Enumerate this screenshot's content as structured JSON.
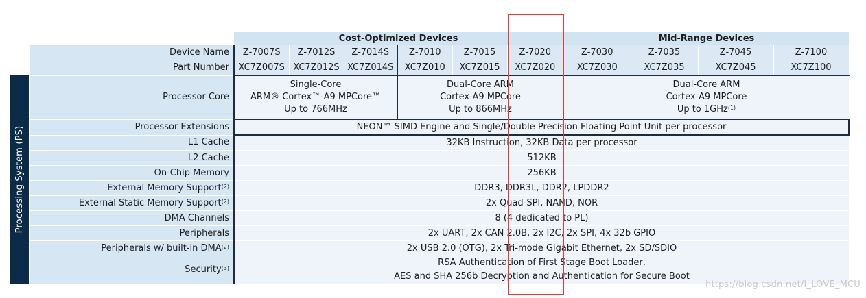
{
  "groups": {
    "cost": "Cost-Optimized Devices",
    "mid": "Mid-Range Devices"
  },
  "side_label": "Processing System (PS)",
  "labels": {
    "device_name": "Device Name",
    "part_number": "Part Number",
    "processor_core": "Processor Core",
    "processor_extensions": "Processor Extensions",
    "l1_cache": "L1 Cache",
    "l2_cache": "L2 Cache",
    "on_chip_memory": "On-Chip Memory",
    "ext_memory": "External Memory Support",
    "ext_static_memory": "External Static Memory Support",
    "dma": "DMA Channels",
    "peripherals": "Peripherals",
    "peripherals_dma": "Peripherals w/ built-in DMA",
    "security": "Security"
  },
  "footnotes": {
    "ext_memory": "(2)",
    "ext_static_memory": "(2)",
    "peripherals_dma": "(2)",
    "security": "(3)",
    "ghz": "(1)"
  },
  "devices": [
    "Z-7007S",
    "Z-7012S",
    "Z-7014S",
    "Z-7010",
    "Z-7015",
    "Z-7020",
    "Z-7030",
    "Z-7035",
    "Z-7045",
    "Z-7100"
  ],
  "parts": [
    "XC7Z007S",
    "XC7Z012S",
    "XC7Z014S",
    "XC7Z010",
    "XC7Z015",
    "XC7Z020",
    "XC7Z030",
    "XC7Z035",
    "XC7Z045",
    "XC7Z100"
  ],
  "core": {
    "single": [
      "Single-Core",
      "ARM® Cortex™-A9 MPCore™",
      "Up to 766MHz"
    ],
    "dual_a": [
      "Dual-Core ARM",
      "Cortex-A9 MPCore",
      "Up to 866MHz"
    ],
    "dual_b": [
      "Dual-Core ARM",
      "Cortex-A9 MPCore",
      "Up to 1GHz"
    ]
  },
  "values": {
    "processor_extensions": "NEON™ SIMD Engine and Single/Double Precision Floating Point Unit per processor",
    "l1_cache": "32KB Instruction, 32KB Data per processor",
    "l2_cache": "512KB",
    "on_chip_memory": "256KB",
    "ext_memory": "DDR3, DDR3L, DDR2, LPDDR2",
    "ext_static_memory": "2x Quad-SPI, NAND, NOR",
    "dma": "8 (4 dedicated to PL)",
    "peripherals": "2x UART, 2x CAN 2.0B, 2x I2C, 2x SPI, 4x 32b GPIO",
    "peripherals_dma": "2x USB 2.0 (OTG), 2x Tri-mode Gigabit Ethernet, 2x SD/SDIO",
    "security_1": "RSA Authentication of First Stage Boot Loader,",
    "security_2": "AES and SHA 256b Decryption and Authentication for Secure Boot"
  },
  "watermark": "https://blog.csdn.net/I_LOVE_MCU",
  "colors": {
    "header": "#d2e3f1",
    "label": "#d6e6f3",
    "value": "#eef4fa",
    "sidebar": "#0c2b48",
    "highlight": "#e53b3b"
  }
}
